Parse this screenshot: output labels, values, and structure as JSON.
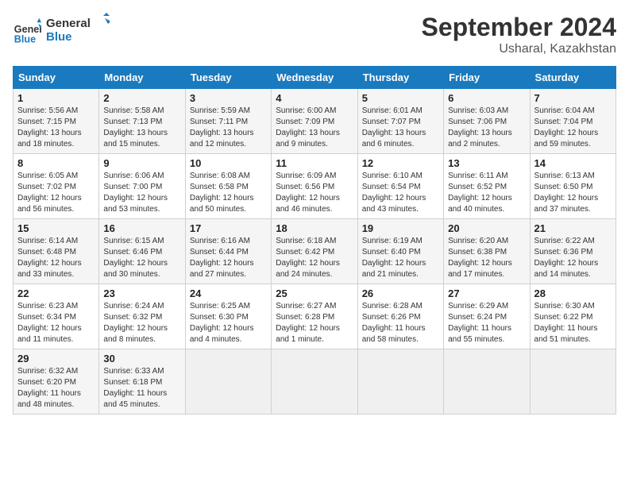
{
  "header": {
    "logo_line1": "General",
    "logo_line2": "Blue",
    "month_year": "September 2024",
    "location": "Usharal, Kazakhstan"
  },
  "weekdays": [
    "Sunday",
    "Monday",
    "Tuesday",
    "Wednesday",
    "Thursday",
    "Friday",
    "Saturday"
  ],
  "weeks": [
    [
      {
        "day": "1",
        "sunrise": "Sunrise: 5:56 AM",
        "sunset": "Sunset: 7:15 PM",
        "daylight": "Daylight: 13 hours and 18 minutes."
      },
      {
        "day": "2",
        "sunrise": "Sunrise: 5:58 AM",
        "sunset": "Sunset: 7:13 PM",
        "daylight": "Daylight: 13 hours and 15 minutes."
      },
      {
        "day": "3",
        "sunrise": "Sunrise: 5:59 AM",
        "sunset": "Sunset: 7:11 PM",
        "daylight": "Daylight: 13 hours and 12 minutes."
      },
      {
        "day": "4",
        "sunrise": "Sunrise: 6:00 AM",
        "sunset": "Sunset: 7:09 PM",
        "daylight": "Daylight: 13 hours and 9 minutes."
      },
      {
        "day": "5",
        "sunrise": "Sunrise: 6:01 AM",
        "sunset": "Sunset: 7:07 PM",
        "daylight": "Daylight: 13 hours and 6 minutes."
      },
      {
        "day": "6",
        "sunrise": "Sunrise: 6:03 AM",
        "sunset": "Sunset: 7:06 PM",
        "daylight": "Daylight: 13 hours and 2 minutes."
      },
      {
        "day": "7",
        "sunrise": "Sunrise: 6:04 AM",
        "sunset": "Sunset: 7:04 PM",
        "daylight": "Daylight: 12 hours and 59 minutes."
      }
    ],
    [
      {
        "day": "8",
        "sunrise": "Sunrise: 6:05 AM",
        "sunset": "Sunset: 7:02 PM",
        "daylight": "Daylight: 12 hours and 56 minutes."
      },
      {
        "day": "9",
        "sunrise": "Sunrise: 6:06 AM",
        "sunset": "Sunset: 7:00 PM",
        "daylight": "Daylight: 12 hours and 53 minutes."
      },
      {
        "day": "10",
        "sunrise": "Sunrise: 6:08 AM",
        "sunset": "Sunset: 6:58 PM",
        "daylight": "Daylight: 12 hours and 50 minutes."
      },
      {
        "day": "11",
        "sunrise": "Sunrise: 6:09 AM",
        "sunset": "Sunset: 6:56 PM",
        "daylight": "Daylight: 12 hours and 46 minutes."
      },
      {
        "day": "12",
        "sunrise": "Sunrise: 6:10 AM",
        "sunset": "Sunset: 6:54 PM",
        "daylight": "Daylight: 12 hours and 43 minutes."
      },
      {
        "day": "13",
        "sunrise": "Sunrise: 6:11 AM",
        "sunset": "Sunset: 6:52 PM",
        "daylight": "Daylight: 12 hours and 40 minutes."
      },
      {
        "day": "14",
        "sunrise": "Sunrise: 6:13 AM",
        "sunset": "Sunset: 6:50 PM",
        "daylight": "Daylight: 12 hours and 37 minutes."
      }
    ],
    [
      {
        "day": "15",
        "sunrise": "Sunrise: 6:14 AM",
        "sunset": "Sunset: 6:48 PM",
        "daylight": "Daylight: 12 hours and 33 minutes."
      },
      {
        "day": "16",
        "sunrise": "Sunrise: 6:15 AM",
        "sunset": "Sunset: 6:46 PM",
        "daylight": "Daylight: 12 hours and 30 minutes."
      },
      {
        "day": "17",
        "sunrise": "Sunrise: 6:16 AM",
        "sunset": "Sunset: 6:44 PM",
        "daylight": "Daylight: 12 hours and 27 minutes."
      },
      {
        "day": "18",
        "sunrise": "Sunrise: 6:18 AM",
        "sunset": "Sunset: 6:42 PM",
        "daylight": "Daylight: 12 hours and 24 minutes."
      },
      {
        "day": "19",
        "sunrise": "Sunrise: 6:19 AM",
        "sunset": "Sunset: 6:40 PM",
        "daylight": "Daylight: 12 hours and 21 minutes."
      },
      {
        "day": "20",
        "sunrise": "Sunrise: 6:20 AM",
        "sunset": "Sunset: 6:38 PM",
        "daylight": "Daylight: 12 hours and 17 minutes."
      },
      {
        "day": "21",
        "sunrise": "Sunrise: 6:22 AM",
        "sunset": "Sunset: 6:36 PM",
        "daylight": "Daylight: 12 hours and 14 minutes."
      }
    ],
    [
      {
        "day": "22",
        "sunrise": "Sunrise: 6:23 AM",
        "sunset": "Sunset: 6:34 PM",
        "daylight": "Daylight: 12 hours and 11 minutes."
      },
      {
        "day": "23",
        "sunrise": "Sunrise: 6:24 AM",
        "sunset": "Sunset: 6:32 PM",
        "daylight": "Daylight: 12 hours and 8 minutes."
      },
      {
        "day": "24",
        "sunrise": "Sunrise: 6:25 AM",
        "sunset": "Sunset: 6:30 PM",
        "daylight": "Daylight: 12 hours and 4 minutes."
      },
      {
        "day": "25",
        "sunrise": "Sunrise: 6:27 AM",
        "sunset": "Sunset: 6:28 PM",
        "daylight": "Daylight: 12 hours and 1 minute."
      },
      {
        "day": "26",
        "sunrise": "Sunrise: 6:28 AM",
        "sunset": "Sunset: 6:26 PM",
        "daylight": "Daylight: 11 hours and 58 minutes."
      },
      {
        "day": "27",
        "sunrise": "Sunrise: 6:29 AM",
        "sunset": "Sunset: 6:24 PM",
        "daylight": "Daylight: 11 hours and 55 minutes."
      },
      {
        "day": "28",
        "sunrise": "Sunrise: 6:30 AM",
        "sunset": "Sunset: 6:22 PM",
        "daylight": "Daylight: 11 hours and 51 minutes."
      }
    ],
    [
      {
        "day": "29",
        "sunrise": "Sunrise: 6:32 AM",
        "sunset": "Sunset: 6:20 PM",
        "daylight": "Daylight: 11 hours and 48 minutes."
      },
      {
        "day": "30",
        "sunrise": "Sunrise: 6:33 AM",
        "sunset": "Sunset: 6:18 PM",
        "daylight": "Daylight: 11 hours and 45 minutes."
      },
      null,
      null,
      null,
      null,
      null
    ]
  ]
}
